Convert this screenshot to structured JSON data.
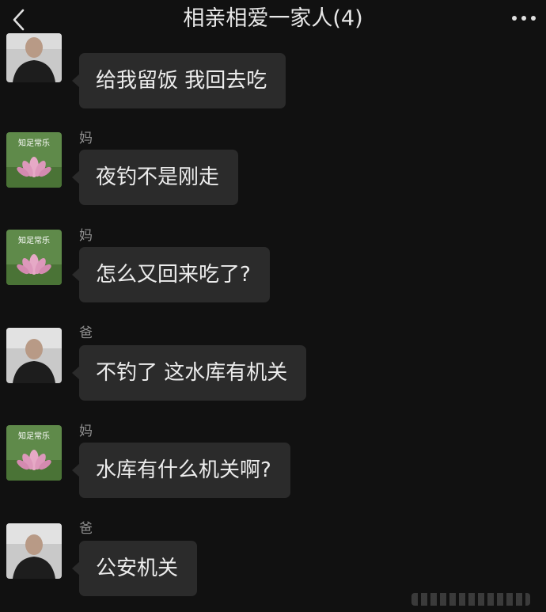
{
  "header": {
    "title": "相亲相爱一家人(4)",
    "back_icon": "chevron-left-icon",
    "more_icon": "more-horizontal-icon"
  },
  "messages": [
    {
      "sender": "",
      "avatar": "dad-photo-avatar",
      "text": "给我留饭 我回去吃"
    },
    {
      "sender": "妈",
      "avatar": "lotus-avatar",
      "avatar_caption": "知足常乐",
      "text": "夜钓不是刚走"
    },
    {
      "sender": "妈",
      "avatar": "lotus-avatar",
      "avatar_caption": "知足常乐",
      "text": "怎么又回来吃了?"
    },
    {
      "sender": "爸",
      "avatar": "dad-photo-avatar",
      "text": "不钓了 这水库有机关"
    },
    {
      "sender": "妈",
      "avatar": "lotus-avatar",
      "avatar_caption": "知足常乐",
      "text": "水库有什么机关啊?"
    },
    {
      "sender": "爸",
      "avatar": "dad-photo-avatar",
      "text": "公安机关"
    }
  ],
  "colors": {
    "background": "#111111",
    "bubble": "#2b2b2b",
    "text": "#ececec",
    "sender": "#8f8f8f"
  }
}
